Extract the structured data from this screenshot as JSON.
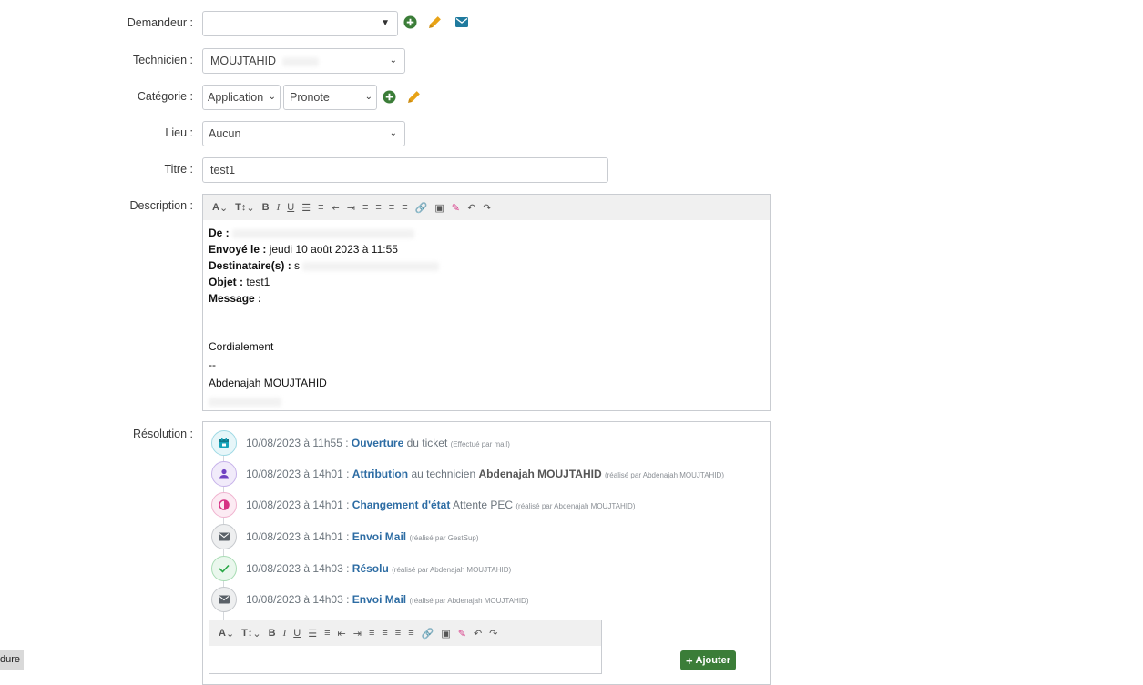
{
  "form": {
    "demandeur": {
      "label": "Demandeur :",
      "value": ""
    },
    "technicien": {
      "label": "Technicien :",
      "value": "MOUJTAHID"
    },
    "categorie": {
      "label": "Catégorie :",
      "value1": "Application",
      "value2": "Pronote"
    },
    "lieu": {
      "label": "Lieu :",
      "value": "Aucun"
    },
    "titre": {
      "label": "Titre :",
      "value": "test1"
    },
    "description": {
      "label": "Description :"
    },
    "resolution": {
      "label": "Résolution :"
    }
  },
  "description": {
    "de_label": "De :",
    "envoye_label": "Envoyé le :",
    "envoye_value": "jeudi 10 août 2023 à 11:55",
    "destinataires_label": "Destinataire(s) :",
    "destinataires_value": "s",
    "objet_label": "Objet :",
    "objet_value": "test1",
    "message_label": "Message :",
    "closing": "Cordialement",
    "sig_sep": "--",
    "signature": "Abdenajah MOUJTAHID"
  },
  "timeline": [
    {
      "date": "10/08/2023 à 11h55 :",
      "action": "Ouverture",
      "rest": "du ticket",
      "note": "(Effectué par mail)",
      "icon": "calendar-icon",
      "color": "#17a2b8"
    },
    {
      "date": "10/08/2023 à 14h01 :",
      "action": "Attribution",
      "rest": "au technicien",
      "strong": "Abdenajah MOUJTAHID",
      "note": "(réalisé par Abdenajah MOUJTAHID)",
      "icon": "user-icon",
      "color": "#6f42c1"
    },
    {
      "date": "10/08/2023 à 14h01 :",
      "action": "Changement d'état",
      "rest": "Attente PEC",
      "note": "(réalisé par Abdenajah MOUJTAHID)",
      "icon": "adjust-icon",
      "color": "#d63384"
    },
    {
      "date": "10/08/2023 à 14h01 :",
      "action": "Envoi Mail",
      "rest": "",
      "note": "(réalisé par GestSup)",
      "icon": "envelope-icon",
      "color": "#6c757d"
    },
    {
      "date": "10/08/2023 à 14h03 :",
      "action": "Résolu",
      "rest": "",
      "note": "(réalisé par Abdenajah MOUJTAHID)",
      "icon": "check-icon",
      "color": "#28a745"
    },
    {
      "date": "10/08/2023 à 14h03 :",
      "action": "Envoi Mail",
      "rest": "",
      "note": "(réalisé par Abdenajah MOUJTAHID)",
      "icon": "envelope-icon",
      "color": "#6c757d"
    }
  ],
  "buttons": {
    "ajouter": "Ajouter",
    "corner": "dure"
  },
  "colors": {
    "accent_green": "#3b7d38",
    "link_blue": "#2e6da4",
    "pencil_orange": "#e8a317"
  }
}
